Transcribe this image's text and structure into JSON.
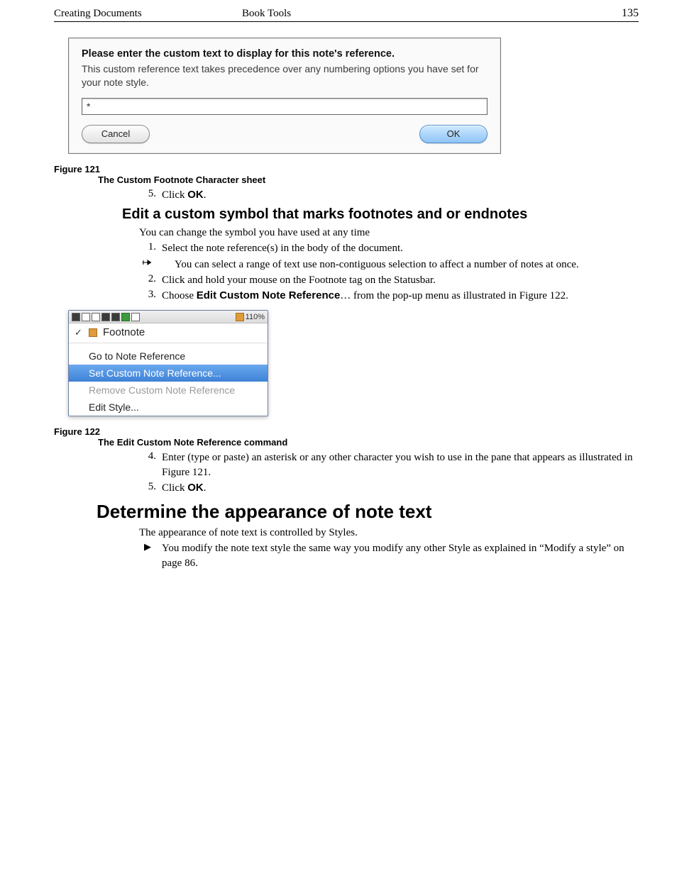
{
  "header": {
    "left": "Creating Documents",
    "center": "Book Tools",
    "page": "135"
  },
  "dialog": {
    "title": "Please enter the custom text to display for this note's reference.",
    "body": "This custom reference text takes precedence over any numbering options you have set for your note style.",
    "input_value": "*",
    "cancel": "Cancel",
    "ok": "OK"
  },
  "fig121": {
    "label": "Figure 121",
    "caption": "The Custom Footnote Character sheet"
  },
  "step5a": {
    "num": "5.",
    "pre": "Click ",
    "bold": "OK",
    "post": "."
  },
  "section_edit": "Edit a custom symbol that marks footnotes and or endnotes",
  "edit_intro": "You can change the symbol you have used at any time",
  "edit_step1": {
    "num": "1.",
    "text": "Select the note reference(s) in the body of the document."
  },
  "edit_tip": "You can select a range of text use non-contiguous selection to affect a number of notes at once.",
  "edit_step2": {
    "num": "2.",
    "text": "Click and hold your mouse on the Footnote tag on the Statusbar."
  },
  "edit_step3": {
    "num": "3.",
    "pre": "Choose ",
    "bold": "Edit Custom Note Reference",
    "post": "… from the pop-up menu as illustrated in Figure 122."
  },
  "menu": {
    "zoom": "110%",
    "heading": "Footnote",
    "items": {
      "goto": "Go to Note Reference",
      "set": "Set Custom Note Reference...",
      "remove": "Remove Custom Note Reference",
      "edit": "Edit Style..."
    }
  },
  "fig122": {
    "label": "Figure 122",
    "caption": "The Edit Custom Note Reference command"
  },
  "post_step4": {
    "num": "4.",
    "text": "Enter (type or paste) an asterisk or any other character you wish to use in the pane that appears as illustrated in Figure 121."
  },
  "post_step5": {
    "num": "5.",
    "pre": "Click ",
    "bold": "OK",
    "post": "."
  },
  "section_determine": "Determine the appearance of note text",
  "det_intro": "The appearance of note text is controlled by Styles.",
  "det_bullet": "You modify the note text style the same way you modify any other Style as explained in “Modify a style” on page 86."
}
